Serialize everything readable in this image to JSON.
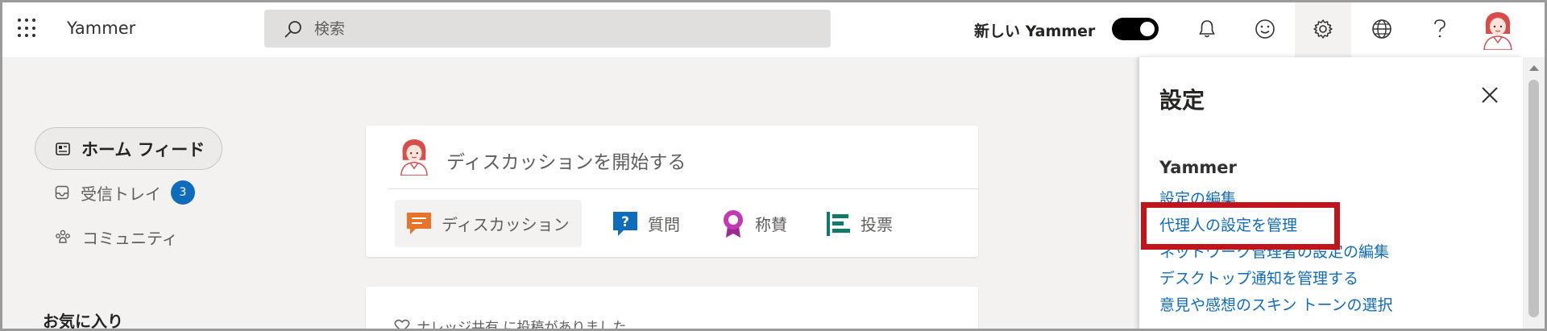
{
  "topbar": {
    "app_name": "Yammer",
    "search_placeholder": "検索",
    "new_yammer_label": "新しい Yammer",
    "new_yammer_toggle_on": true,
    "icons": [
      "waffle-icon",
      "bell-icon",
      "smiley-icon",
      "gear-icon",
      "globe-icon",
      "help-icon"
    ]
  },
  "nav": {
    "home": "ホーム フィード",
    "inbox": "受信トレイ",
    "inbox_count": "3",
    "communities": "コミュニティ",
    "favorites": "お気に入り"
  },
  "publisher": {
    "prompt": "ディスカッションを開始する",
    "tabs": {
      "discussion": "ディスカッション",
      "question": "質問",
      "praise": "称賛",
      "poll": "投票"
    }
  },
  "feed": {
    "first_post": "ナレッジ共有 に投稿がありました"
  },
  "settings_panel": {
    "title": "設定",
    "section": "Yammer",
    "links": {
      "edit_settings": "設定の編集",
      "delegate": "代理人の設定を管理",
      "network_admin": "ネットワーク管理者の設定の編集",
      "desktop_notifications": "デスクトップ通知を管理する",
      "skin_tone": "意見や感想のスキン トーンの選択"
    },
    "highlighted_link": "代理人の設定を管理"
  },
  "colors": {
    "accent": "#0f6cbd",
    "highlight": "#c0161b",
    "discussion_icon": "#e8742c",
    "question_icon": "#0f6cbd",
    "praise_icon": "#c239b3",
    "poll_icon": "#0e7a6b"
  }
}
